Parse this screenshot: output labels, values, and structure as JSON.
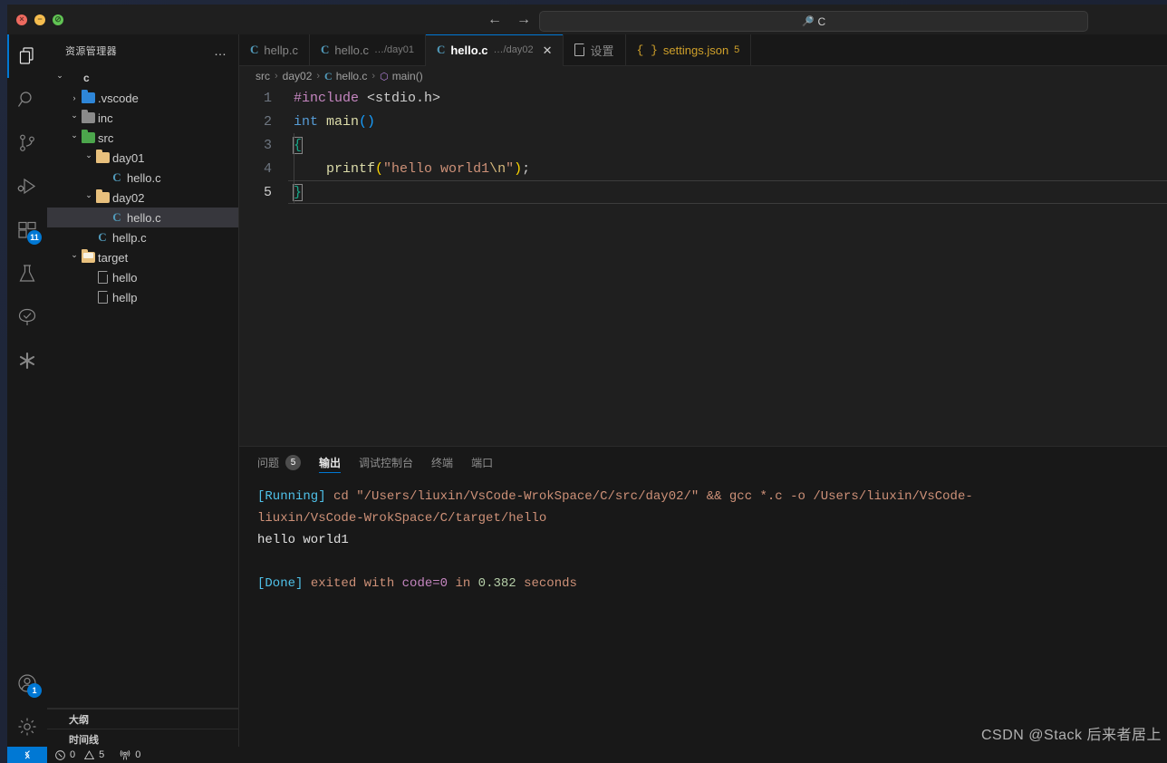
{
  "window": {
    "traffic": [
      {
        "name": "close",
        "color": "#ee6a5f",
        "glyph": "×"
      },
      {
        "name": "minimize",
        "color": "#f5bd4f",
        "glyph": "−"
      },
      {
        "name": "maximize",
        "color": "#61c454",
        "glyph": "∕"
      }
    ],
    "nav": {
      "back": "←",
      "forward": "→"
    },
    "search": {
      "value": "C",
      "icon": "search-icon",
      "placeholder": ""
    }
  },
  "activity_bar": {
    "items": [
      {
        "name": "explorer",
        "label": "资源管理器",
        "icon": "files-icon",
        "active": true,
        "badge": ""
      },
      {
        "name": "search",
        "label": "搜索",
        "icon": "search-icon",
        "active": false,
        "badge": ""
      },
      {
        "name": "source-control",
        "label": "源代码管理",
        "icon": "source-control-icon",
        "active": false,
        "badge": ""
      },
      {
        "name": "run-debug",
        "label": "运行和调试",
        "icon": "run-debug-icon",
        "active": false,
        "badge": ""
      },
      {
        "name": "extensions",
        "label": "扩展",
        "icon": "extensions-icon",
        "active": false,
        "badge": "11"
      },
      {
        "name": "testing",
        "label": "测试",
        "icon": "beaker-icon",
        "active": false,
        "badge": ""
      },
      {
        "name": "remote-explorer",
        "label": "远程资源管理器",
        "icon": "tree-check-icon",
        "active": false,
        "badge": ""
      },
      {
        "name": "misc",
        "label": "扩展工具",
        "icon": "asterisk-icon",
        "active": false,
        "badge": ""
      }
    ],
    "bottom": [
      {
        "name": "accounts",
        "label": "帐户",
        "icon": "account-icon",
        "badge": "1"
      },
      {
        "name": "manage",
        "label": "管理",
        "icon": "gear-icon",
        "badge": ""
      }
    ]
  },
  "sidebar": {
    "title": "资源管理器",
    "more_actions": "…",
    "tree": [
      {
        "label": "c",
        "indent": 0,
        "chev": "down",
        "icon": "none",
        "bold": true,
        "selected": false
      },
      {
        "label": ".vscode",
        "indent": 1,
        "chev": "right",
        "icon": "folder-vscode",
        "bold": false,
        "selected": false
      },
      {
        "label": "inc",
        "indent": 1,
        "chev": "down",
        "icon": "folder-gray",
        "bold": false,
        "selected": false
      },
      {
        "label": "src",
        "indent": 1,
        "chev": "down",
        "icon": "folder-green",
        "bold": false,
        "selected": false
      },
      {
        "label": "day01",
        "indent": 2,
        "chev": "down",
        "icon": "folder-tan",
        "bold": false,
        "selected": false
      },
      {
        "label": "hello.c",
        "indent": 3,
        "chev": "none",
        "icon": "c-file",
        "bold": false,
        "selected": false
      },
      {
        "label": "day02",
        "indent": 2,
        "chev": "down",
        "icon": "folder-tan",
        "bold": false,
        "selected": false
      },
      {
        "label": "hello.c",
        "indent": 3,
        "chev": "none",
        "icon": "c-file",
        "bold": false,
        "selected": true
      },
      {
        "label": "hellp.c",
        "indent": 2,
        "chev": "none",
        "icon": "c-file",
        "bold": false,
        "selected": false
      },
      {
        "label": "target",
        "indent": 1,
        "chev": "down",
        "icon": "folder-open-tan",
        "bold": false,
        "selected": false
      },
      {
        "label": "hello",
        "indent": 2,
        "chev": "none",
        "icon": "doc-file",
        "bold": false,
        "selected": false
      },
      {
        "label": "hellp",
        "indent": 2,
        "chev": "none",
        "icon": "doc-file",
        "bold": false,
        "selected": false
      }
    ],
    "sections": [
      {
        "label": "大纲",
        "chev": "right"
      },
      {
        "label": "时间线",
        "chev": "right"
      }
    ]
  },
  "editor": {
    "tabs": [
      {
        "name": "hellp.c",
        "desc": "",
        "icon": "c-file",
        "active": false,
        "dirty": false,
        "closable": false,
        "badge": ""
      },
      {
        "name": "hello.c",
        "desc": "…/day01",
        "icon": "c-file",
        "active": false,
        "dirty": false,
        "closable": false,
        "badge": ""
      },
      {
        "name": "hello.c",
        "desc": "…/day02",
        "icon": "c-file",
        "active": true,
        "dirty": false,
        "closable": true,
        "badge": ""
      },
      {
        "name": "设置",
        "desc": "",
        "icon": "settings-doc",
        "active": false,
        "dirty": false,
        "closable": false,
        "badge": ""
      },
      {
        "name": "settings.json",
        "desc": "",
        "icon": "json-file",
        "active": false,
        "dirty": false,
        "closable": false,
        "badge": "5"
      }
    ],
    "close_glyph": "✕",
    "breadcrumb": [
      {
        "label": "src",
        "icon": "none"
      },
      {
        "label": "day02",
        "icon": "none"
      },
      {
        "label": "hello.c",
        "icon": "c-file"
      },
      {
        "label": "main()",
        "icon": "symbol-method"
      }
    ],
    "breadcrumb_sep": "›",
    "code": {
      "current_line": 5,
      "lines": [
        {
          "num": "1",
          "tokens": [
            {
              "t": "#include ",
              "c": "t-pre"
            },
            {
              "t": "<stdio.h>",
              "c": "t-inc"
            }
          ]
        },
        {
          "num": "2",
          "tokens": [
            {
              "t": "int ",
              "c": "t-key"
            },
            {
              "t": "main",
              "c": "t-fn"
            },
            {
              "t": "()",
              "c": "t-brc"
            }
          ]
        },
        {
          "num": "3",
          "tokens": [
            {
              "t": "{",
              "c": "t-brace-g"
            }
          ]
        },
        {
          "num": "4",
          "tokens": [
            {
              "t": "    ",
              "c": "t-pun"
            },
            {
              "t": "printf",
              "c": "t-fn"
            },
            {
              "t": "(",
              "c": "t-yel"
            },
            {
              "t": "\"hello world1",
              "c": "t-str"
            },
            {
              "t": "\\n",
              "c": "t-esc"
            },
            {
              "t": "\"",
              "c": "t-str"
            },
            {
              "t": ")",
              "c": "t-yel"
            },
            {
              "t": ";",
              "c": "t-pun"
            }
          ]
        },
        {
          "num": "5",
          "tokens": [
            {
              "t": "}",
              "c": "t-brace-g"
            }
          ]
        }
      ]
    }
  },
  "panel": {
    "tabs": [
      {
        "label": "问题",
        "badge": "5",
        "active": false
      },
      {
        "label": "输出",
        "badge": "",
        "active": true
      },
      {
        "label": "调试控制台",
        "badge": "",
        "active": false
      },
      {
        "label": "终端",
        "badge": "",
        "active": false
      },
      {
        "label": "端口",
        "badge": "",
        "active": false
      }
    ],
    "output": [
      [
        {
          "t": "[Running]",
          "c": "o-run"
        },
        {
          "t": " cd ",
          "c": "o-path"
        },
        {
          "t": "\"/Users/liuxin/VsCode-WrokSpace/C/src/day02/\" && gcc *.c -o /Users/liuxin/VsCode-",
          "c": "o-path"
        }
      ],
      [
        {
          "t": "liuxin/VsCode-WrokSpace/C/target/hello",
          "c": "o-path"
        }
      ],
      [
        {
          "t": "hello world1",
          "c": "o-white"
        }
      ],
      [
        {
          "t": " ",
          "c": "o-plain"
        }
      ],
      [
        {
          "t": "[Done]",
          "c": "o-done"
        },
        {
          "t": " exited with ",
          "c": "o-path"
        },
        {
          "t": "code=0",
          "c": "o-code"
        },
        {
          "t": " in ",
          "c": "o-path"
        },
        {
          "t": "0.382",
          "c": "o-num"
        },
        {
          "t": " seconds",
          "c": "o-path"
        }
      ]
    ],
    "watermark": "CSDN @Stack 后来者居上"
  },
  "statusbar": {
    "remote_icon": "remote-icon",
    "items": [
      {
        "name": "errors",
        "icon": "error-icon",
        "value": "0"
      },
      {
        "name": "warnings",
        "icon": "warning-icon",
        "value": "5"
      },
      {
        "name": "radio-tower",
        "icon": "radio-tower-icon",
        "value": "0"
      }
    ]
  }
}
